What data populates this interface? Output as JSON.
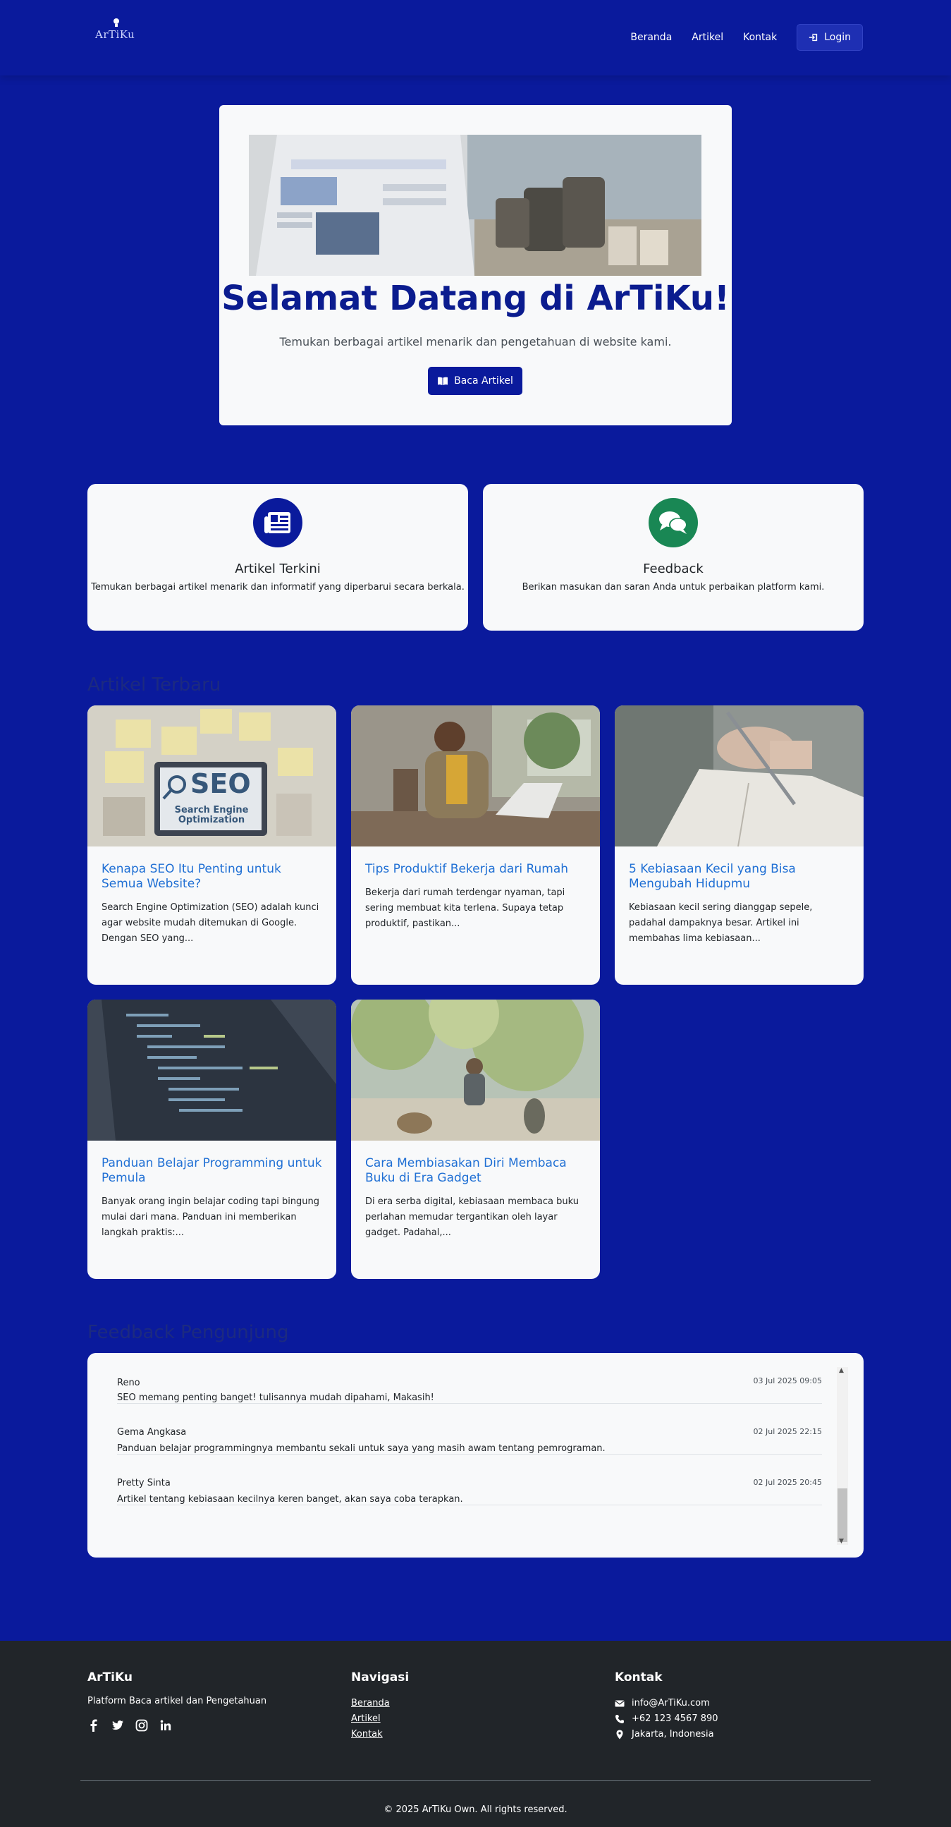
{
  "navbar": {
    "logo_text": "ArTiKu",
    "links": [
      "Beranda",
      "Artikel",
      "Kontak"
    ],
    "login_label": "Login"
  },
  "hero": {
    "title": "Selamat Datang di ArTiKu!",
    "subtitle": "Temukan berbagai artikel menarik dan pengetahuan di website kami.",
    "button_label": "Baca Artikel"
  },
  "features": [
    {
      "icon": "newspaper-icon",
      "color": "#0a1a9c",
      "title": "Artikel Terkini",
      "desc": "Temukan berbagai artikel menarik dan informatif yang diperbarui secara berkala."
    },
    {
      "icon": "comments-icon",
      "color": "#198754",
      "title": "Feedback",
      "desc": "Berikan masukan dan saran Anda untuk perbaikan platform kami."
    }
  ],
  "articles_section_title": "Artikel Terbaru",
  "articles": [
    {
      "title": "Kenapa SEO Itu Penting untuk Semua Website?",
      "desc": "Search Engine Optimization (SEO) adalah kunci agar website mudah ditemukan di Google. Dengan SEO yang...",
      "image_text": "SEO",
      "image_subtext": "Search Engine Optimization"
    },
    {
      "title": "Tips Produktif Bekerja dari Rumah",
      "desc": "Bekerja dari rumah terdengar nyaman, tapi sering membuat kita terlena. Supaya tetap produktif, pastikan..."
    },
    {
      "title": "5 Kebiasaan Kecil yang Bisa Mengubah Hidupmu",
      "desc": "Kebiasaan kecil sering dianggap sepele, padahal dampaknya besar. Artikel ini membahas lima kebiasaan..."
    },
    {
      "title": "Panduan Belajar Programming untuk Pemula",
      "desc": "Banyak orang ingin belajar coding tapi bingung mulai dari mana. Panduan ini memberikan langkah praktis:..."
    },
    {
      "title": "Cara Membiasakan Diri Membaca Buku di Era Gadget",
      "desc": "Di era serba digital, kebiasaan membaca buku perlahan memudar tergantikan oleh layar gadget. Padahal,..."
    }
  ],
  "feedback_section_title": "Feedback Pengunjung",
  "feedback": [
    {
      "name": "Reno",
      "date": "03 Jul 2025 09:05",
      "text": "SEO memang penting banget! tulisannya mudah dipahami, Makasih!"
    },
    {
      "name": "Gema Angkasa",
      "date": "02 Jul 2025 22:15",
      "text": "Panduan belajar programmingnya membantu sekali untuk saya yang masih awam tentang pemrograman."
    },
    {
      "name": "Pretty Sinta",
      "date": "02 Jul 2025 20:45",
      "text": "Artikel tentang kebiasaan kecilnya keren banget, akan saya coba terapkan."
    }
  ],
  "footer": {
    "brand_title": "ArTiKu",
    "brand_desc": "Platform Baca artikel dan Pengetahuan",
    "socials": [
      "facebook-icon",
      "twitter-icon",
      "instagram-icon",
      "linkedin-icon"
    ],
    "nav_title": "Navigasi",
    "nav_links": [
      "Beranda",
      "Artikel",
      "Kontak"
    ],
    "contact_title": "Kontak",
    "email": "info@ArTiKu.com",
    "phone": "+62 123 4567 890",
    "address": "Jakarta, Indonesia",
    "copyright": "© 2025 ArTiKu Own. All rights reserved."
  }
}
